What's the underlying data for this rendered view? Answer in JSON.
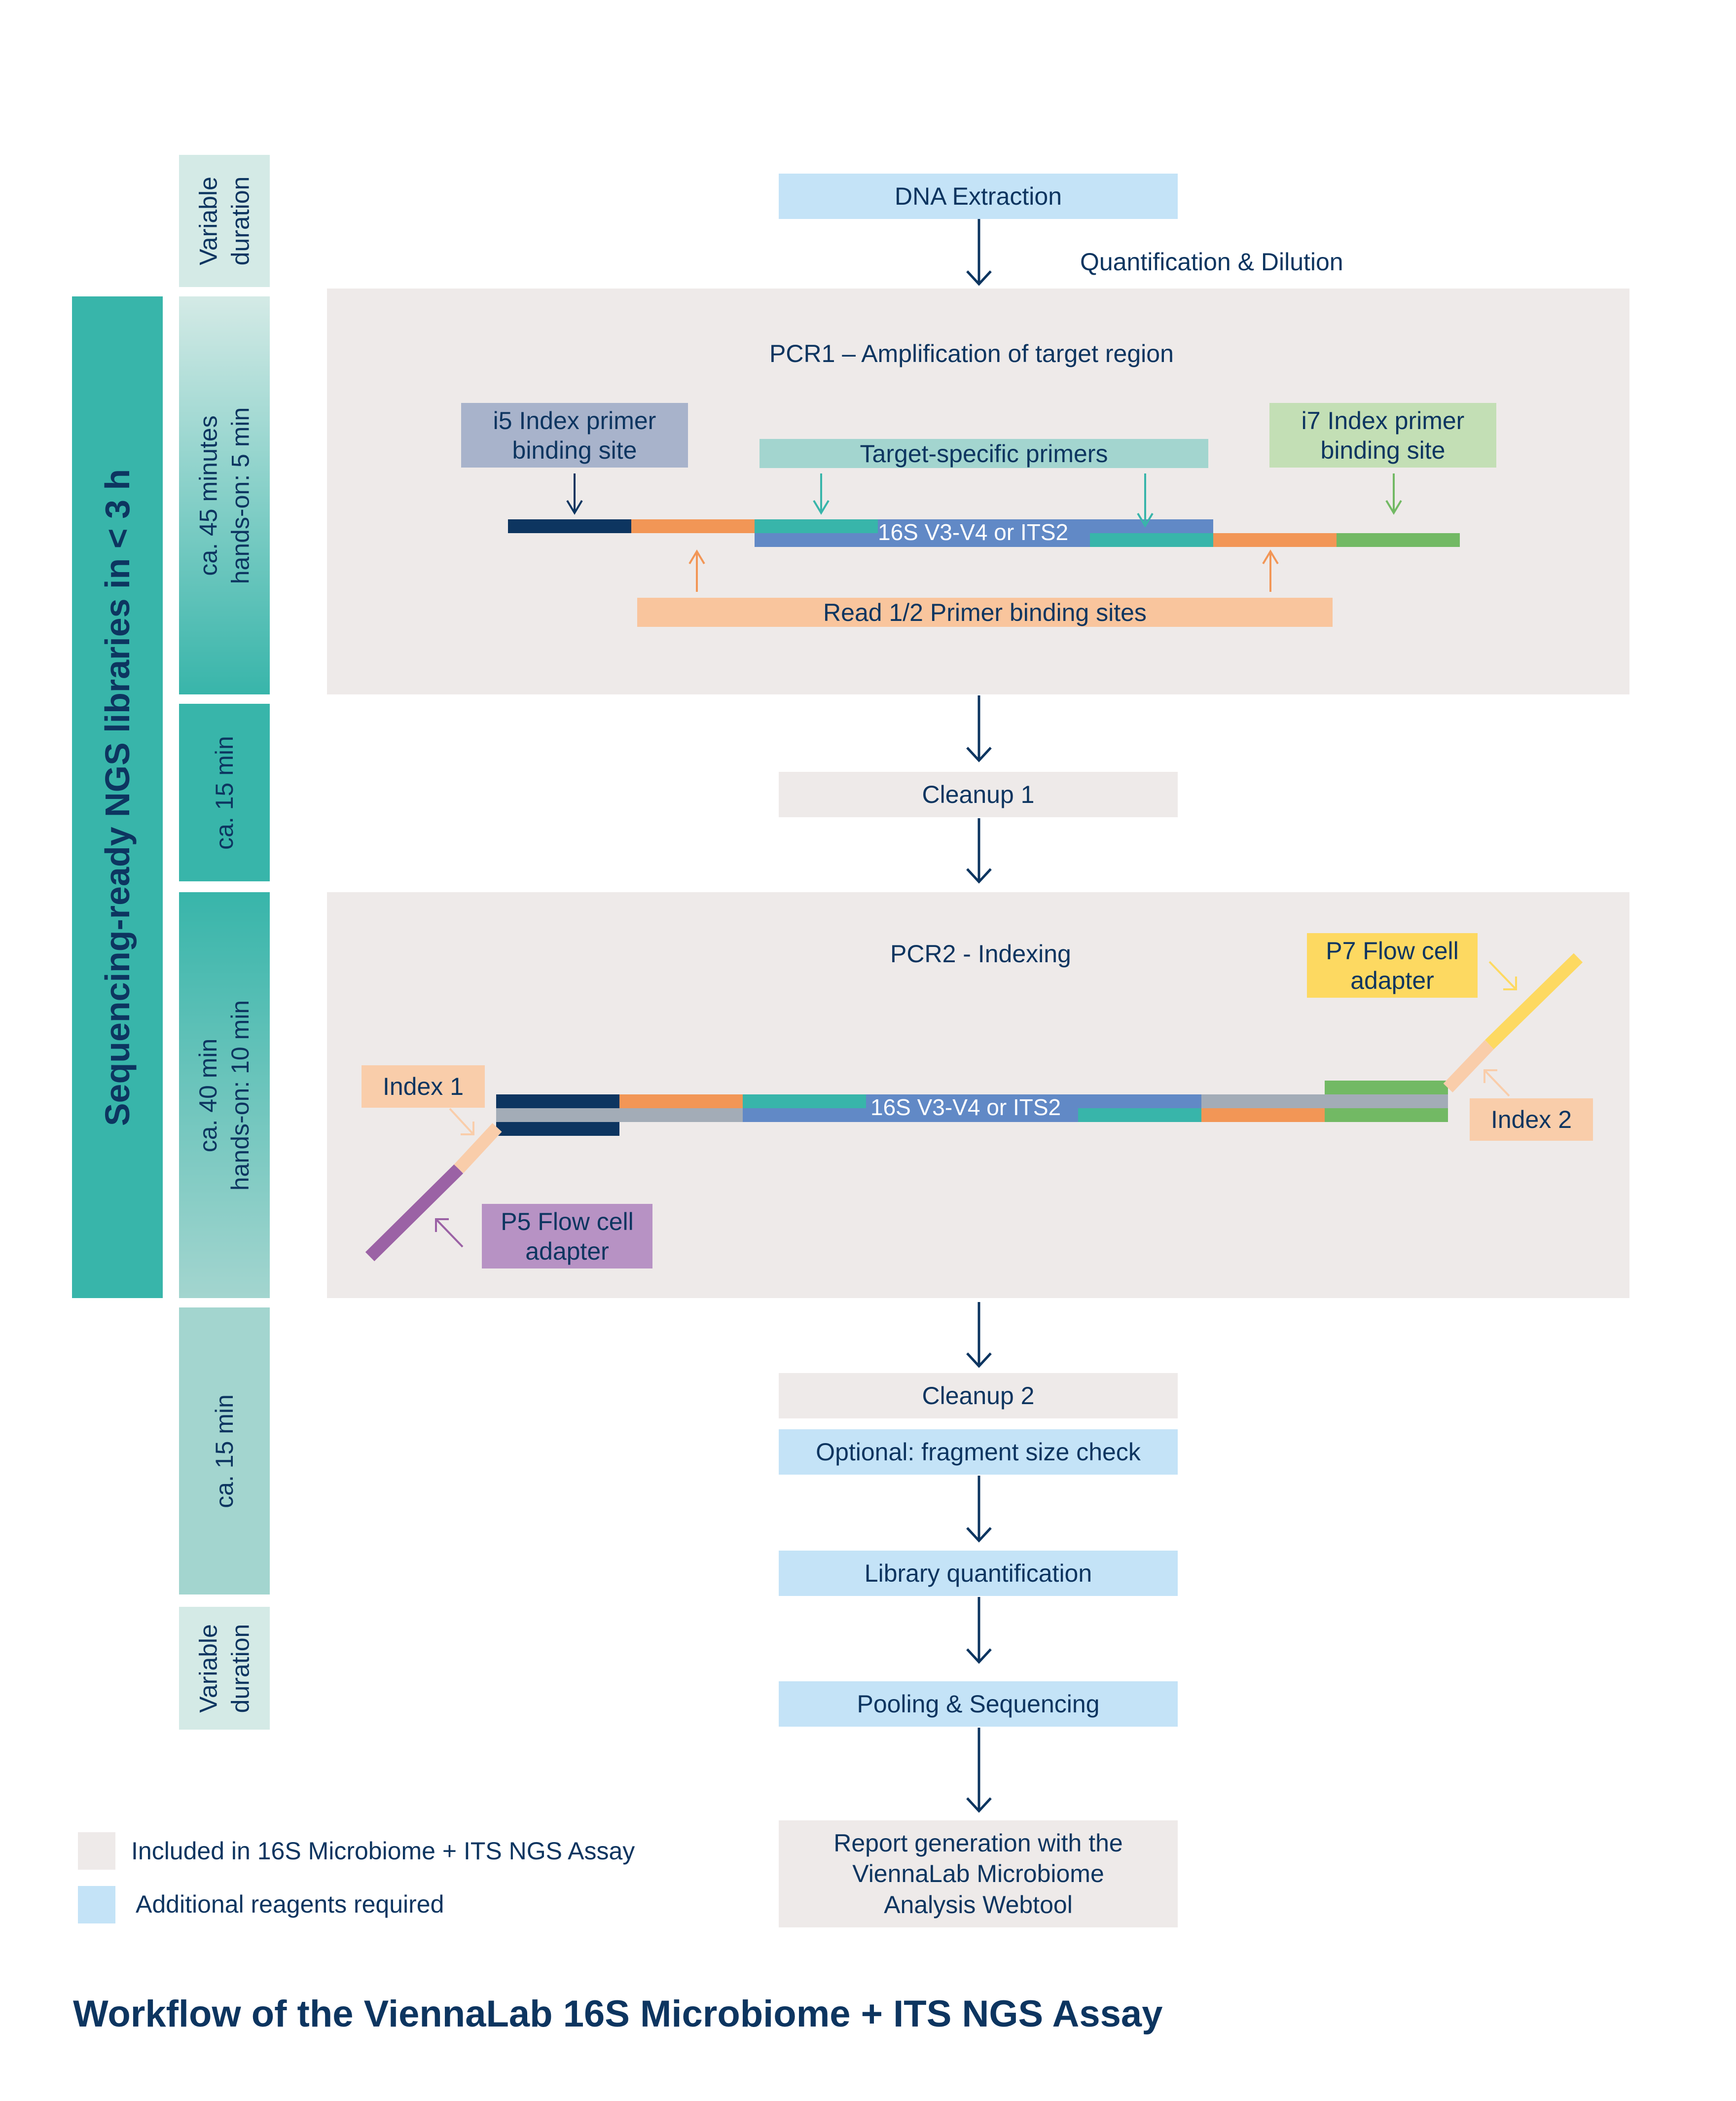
{
  "title": "Workflow of the ViennaLab 16S Microbiome + ITS NGS Assay",
  "summary_bar": "Sequencing-ready NGS libraries in < 3 h",
  "colors": {
    "included": "#eeeae9",
    "additional": "#c4e3f7",
    "teal": "#38b5aa",
    "navy": "#0d3560"
  },
  "durations": [
    {
      "text": "Variable\nduration"
    },
    {
      "text": "ca. 45 minutes\nhands-on: 5 min"
    },
    {
      "text": "ca. 15 min"
    },
    {
      "text": "ca. 40 min\nhands-on: 10 min"
    },
    {
      "text": "ca. 15 min"
    },
    {
      "text": "Variable\nduration"
    }
  ],
  "steps": {
    "dna_extraction": "DNA Extraction",
    "quant_dilution": "Quantification & Dilution",
    "cleanup1": "Cleanup 1",
    "cleanup2": "Cleanup 2",
    "fragment_check": "Optional: fragment size check",
    "library_quant": "Library quantification",
    "pooling": "Pooling & Sequencing",
    "report": "Report generation with the ViennaLab Microbiome Analysis Webtool"
  },
  "pcr1": {
    "title": "PCR1 – Amplification of target region",
    "i5_label": "i5 Index primer binding site",
    "target_primers": "Target-specific primers",
    "i7_label": "i7 Index primer binding site",
    "target_region": "16S V3-V4 or ITS2",
    "read_primers": "Read 1/2 Primer binding sites"
  },
  "pcr2": {
    "title": "PCR2 - Indexing",
    "p7_label": "P7 Flow cell adapter",
    "index1": "Index 1",
    "index2": "Index 2",
    "target_region": "16S V3-V4 or ITS2",
    "p5_label": "P5 Flow cell adapter"
  },
  "legend": [
    {
      "label": "Included in 16S Microbiome + ITS NGS Assay",
      "color": "#eeeae9"
    },
    {
      "label": "Additional reagents required",
      "color": "#c4e3f7"
    }
  ]
}
